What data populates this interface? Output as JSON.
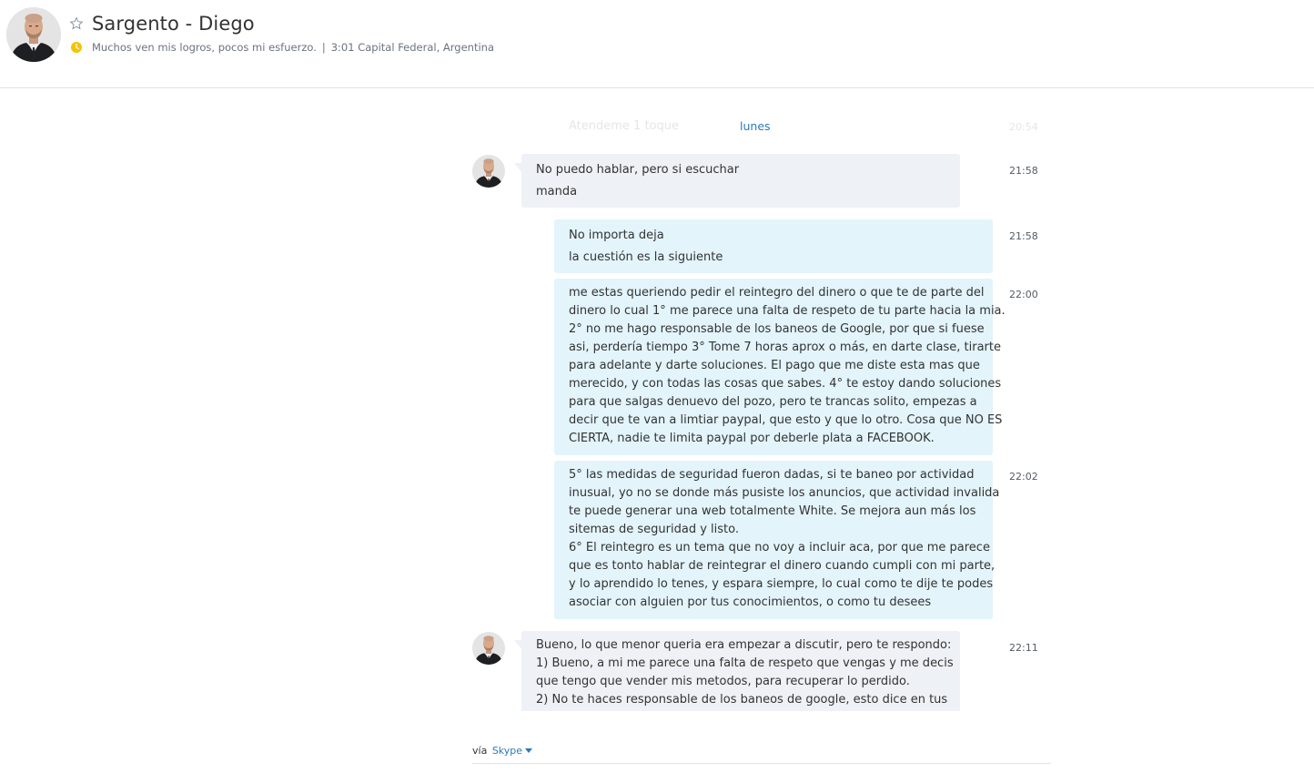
{
  "header": {
    "contact_name": "Sargento - Diego",
    "mood": "Muchos ven mis logros, pocos mi esfuerzo.",
    "separator": "|",
    "local_time_location": "3:01 Capital Federal, Argentina",
    "status": "away",
    "status_color": "#f5c400",
    "favorite_icon": "star-outline-icon"
  },
  "conversation": {
    "faded_message": {
      "text": "Atendeme 1 toque",
      "time": "20:54"
    },
    "day_label": "lunes",
    "messages": [
      {
        "direction": "incoming",
        "time": "21:58",
        "lines": [
          "No puedo hablar, pero si escuchar",
          "manda"
        ]
      },
      {
        "direction": "outgoing",
        "time": "21:58",
        "lines": [
          "No importa deja",
          "la cuestión es la siguiente"
        ]
      },
      {
        "direction": "outgoing",
        "time": "22:00",
        "lines": [
          "me estas queriendo pedir el reintegro del dinero o que te de parte del",
          "dinero lo cual 1° me parece una falta de respeto de tu parte hacia la mia.",
          "2° no me hago responsable de los baneos de Google, por que si fuese",
          "asi, perdería tiempo 3° Tome 7 horas aprox o más, en darte clase, tirarte",
          "para adelante y darte soluciones. El pago que me diste esta mas que",
          "merecido, y con todas las cosas que sabes. 4° te estoy dando soluciones",
          "para que salgas denuevo del pozo, pero te trancas solito, empezas a",
          "decir que te van a limtiar paypal, que esto y que lo otro. Cosa que NO ES",
          "CIERTA, nadie te limita paypal por deberle plata a FACEBOOK."
        ]
      },
      {
        "direction": "outgoing",
        "time": "22:02",
        "lines": [
          "5° las medidas de seguridad fueron dadas, si te baneo por actividad",
          "inusual, yo no se donde más pusiste los anuncios, que actividad invalida",
          "te puede generar una web totalmente White. Se mejora aun más los",
          "sitemas de seguridad y listo.",
          "6° El reintegro es un tema que no voy a incluir aca, por que me parece",
          "que es tonto hablar de reintegrar el dinero cuando cumpli con mi parte,",
          "y lo aprendido lo tenes, y espara siempre, lo cual como te dije te podes",
          "asociar con alguien por tus conocimientos, o como tu desees"
        ]
      },
      {
        "direction": "incoming",
        "time": "22:11",
        "lines": [
          "Bueno, lo que menor queria era empezar a discutir, pero te respondo:",
          "1) Bueno, a mi me parece una falta de respeto que vengas y me decis",
          "que tengo que vender mis metodos, para recuperar lo perdido.",
          "2) No te haces responsable de los baneos de google, esto dice en tus"
        ]
      }
    ]
  },
  "footer": {
    "via_label": "vía",
    "service_link": "Skype"
  },
  "colors": {
    "incoming_bubble": "#eef1f5",
    "outgoing_bubble": "#e3f4fb",
    "link": "#2a7ab8"
  }
}
